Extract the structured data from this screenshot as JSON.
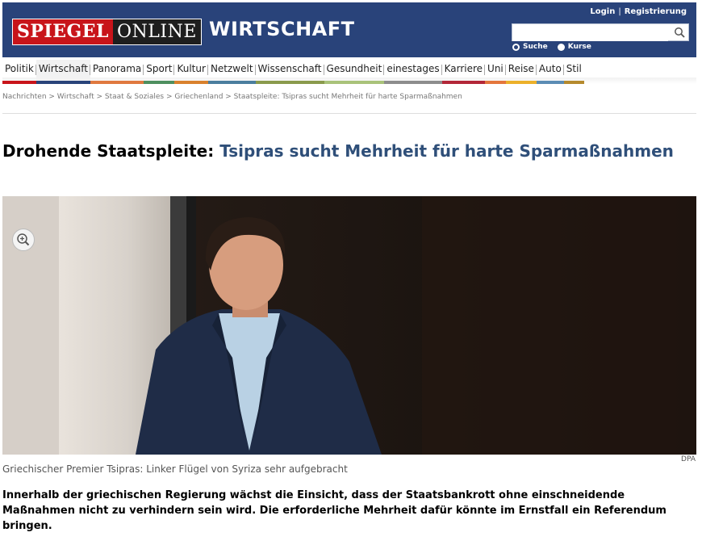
{
  "header": {
    "logo_left": "SPIEGEL",
    "logo_right": "ONLINE",
    "section": "WIRTSCHAFT",
    "login": "Login",
    "register": "Registrierung",
    "separator": "|",
    "search_value": "",
    "search_placeholder": "",
    "radio_suche": "Suche",
    "radio_kurse": "Kurse",
    "bg_color": "#29437a"
  },
  "nav": {
    "items": [
      {
        "label": "Politik",
        "color": "#c8141a"
      },
      {
        "label": "Wirtschaft",
        "color": "#29437a"
      },
      {
        "label": "Panorama",
        "color": "#e0793f"
      },
      {
        "label": "Sport",
        "color": "#4e8f5f"
      },
      {
        "label": "Kultur",
        "color": "#d9812d"
      },
      {
        "label": "Netzwelt",
        "color": "#4b7e9e"
      },
      {
        "label": "Wissenschaft",
        "color": "#8a9a4c"
      },
      {
        "label": "Gesundheit",
        "color": "#a9c27a"
      },
      {
        "label": "einestages",
        "color": "#8d8d8d"
      },
      {
        "label": "Karriere",
        "color": "#b22738"
      },
      {
        "label": "Uni",
        "color": "#e4763c"
      },
      {
        "label": "Reise",
        "color": "#ecb02a"
      },
      {
        "label": "Auto",
        "color": "#5b8cb4"
      },
      {
        "label": "Stil",
        "color": "#b58a2d"
      }
    ]
  },
  "breadcrumb": "Nachrichten > Wirtschaft > Staat & Soziales > Griechenland > Staatspleite: Tsipras sucht Mehrheit für harte Sparmaßnahmen",
  "article": {
    "kicker": "Drohende Staatspleite:",
    "title": "Tsipras sucht Mehrheit für harte Sparmaßnahmen",
    "photo_credit": "DPA",
    "caption": "Griechischer Premier Tsipras: Linker Flügel von Syriza sehr aufgebracht",
    "lead": "Innerhalb der griechischen Regierung wächst die Einsicht, dass der Staatsbankrott ohne einschneidende Maßnahmen nicht zu verhindern sein wird. Die erforderliche Mehrheit dafür könnte im Ernstfall ein Referendum bringen."
  }
}
